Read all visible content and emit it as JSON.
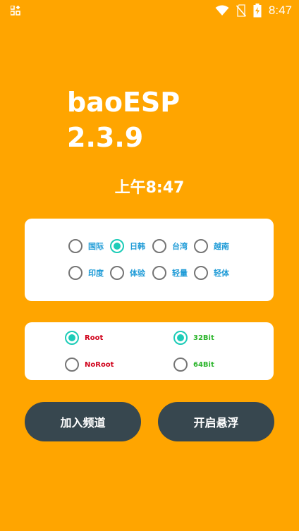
{
  "status_bar": {
    "time": "8:47",
    "icons": [
      "wifi-icon",
      "no-sim-icon",
      "battery-charging-icon"
    ]
  },
  "app": {
    "title_line1": "baoESP",
    "title_line2": "2.3.9"
  },
  "clock": {
    "text": "上午8:47"
  },
  "region_options": [
    {
      "label": "国际",
      "checked": false
    },
    {
      "label": "日韩",
      "checked": true
    },
    {
      "label": "台湾",
      "checked": false
    },
    {
      "label": "越南",
      "checked": false
    },
    {
      "label": "印度",
      "checked": false
    },
    {
      "label": "体验",
      "checked": false
    },
    {
      "label": "轻量",
      "checked": false
    },
    {
      "label": "轻体",
      "checked": false
    }
  ],
  "root_options": [
    {
      "label": "Root",
      "checked": true
    },
    {
      "label": "NoRoot",
      "checked": false
    }
  ],
  "bit_options": [
    {
      "label": "32Bit",
      "checked": true
    },
    {
      "label": "64Bit",
      "checked": false
    }
  ],
  "buttons": {
    "join_channel": "加入频道",
    "open_float": "开启悬浮"
  },
  "colors": {
    "background": "#FFA500",
    "card": "#FFFFFF",
    "radio_checked": "#1DCCB8",
    "radio_unchecked": "#757575",
    "region_label": "#1E9BD7",
    "root_label": "#D0021B",
    "bit_label": "#2CB52C",
    "button": "#37474F",
    "button_text": "#FFFFFF"
  }
}
